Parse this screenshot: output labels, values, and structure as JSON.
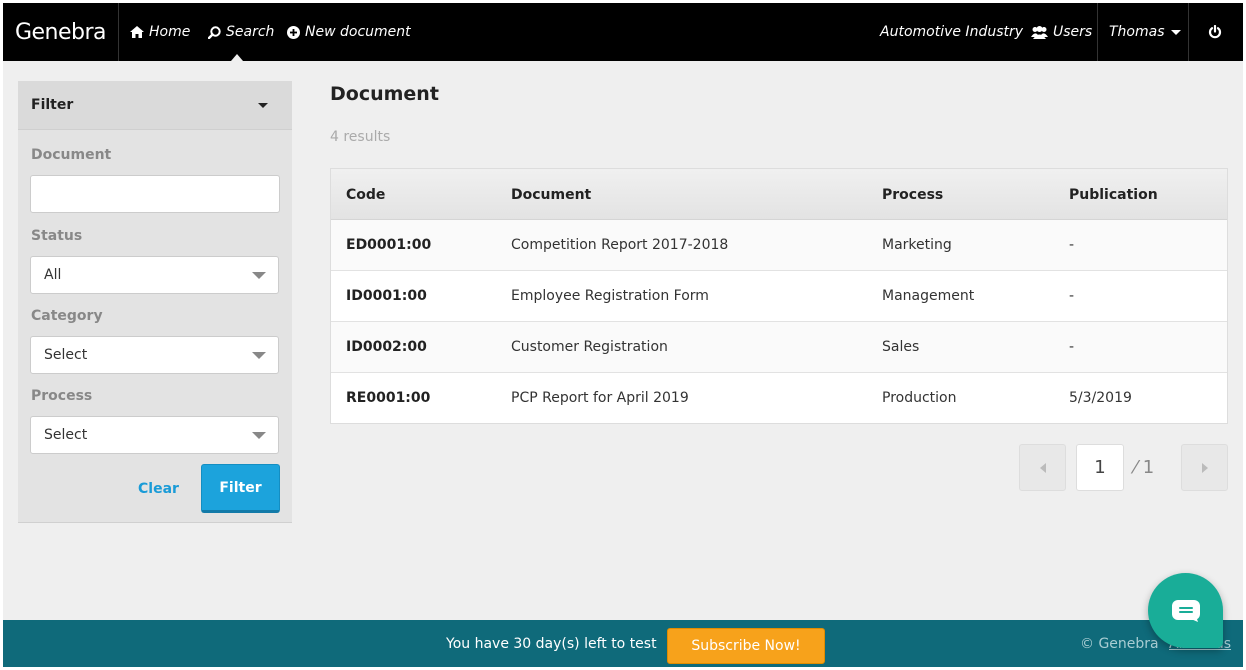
{
  "brand": "Genebra",
  "nav": {
    "home": "Home",
    "search": "Search",
    "new_document": "New document",
    "company": "Automotive Industry",
    "users": "Users",
    "user_name": "Thomas"
  },
  "filter": {
    "title": "Filter",
    "document_label": "Document",
    "document_value": "",
    "status_label": "Status",
    "status_value": "All",
    "category_label": "Category",
    "category_value": "Select",
    "process_label": "Process",
    "process_value": "Select",
    "clear": "Clear",
    "submit": "Filter"
  },
  "main": {
    "title": "Document",
    "results": "4 results",
    "columns": [
      "Code",
      "Document",
      "Process",
      "Publication"
    ],
    "rows": [
      [
        "ED0001:00",
        "Competition Report 2017-2018",
        "Marketing",
        "-"
      ],
      [
        "ID0001:00",
        "Employee Registration Form",
        "Management",
        "-"
      ],
      [
        "ID0002:00",
        "Customer Registration",
        "Sales",
        "-"
      ],
      [
        "RE0001:00",
        "PCP Report for April 2019",
        "Production",
        "5/3/2019"
      ]
    ]
  },
  "pagination": {
    "current": "1",
    "total": "⁄ 1"
  },
  "footer": {
    "trial_text": "You have 30 day(s) left to test",
    "subscribe": "Subscribe Now!",
    "copyright": "© Genebra",
    "about": "About us"
  },
  "colors": {
    "nav_bg": "#000000",
    "accent": "#1ca3dc",
    "footer_bg": "#0f6a7a",
    "subscribe": "#f7a21b",
    "chat": "#19ad98"
  }
}
